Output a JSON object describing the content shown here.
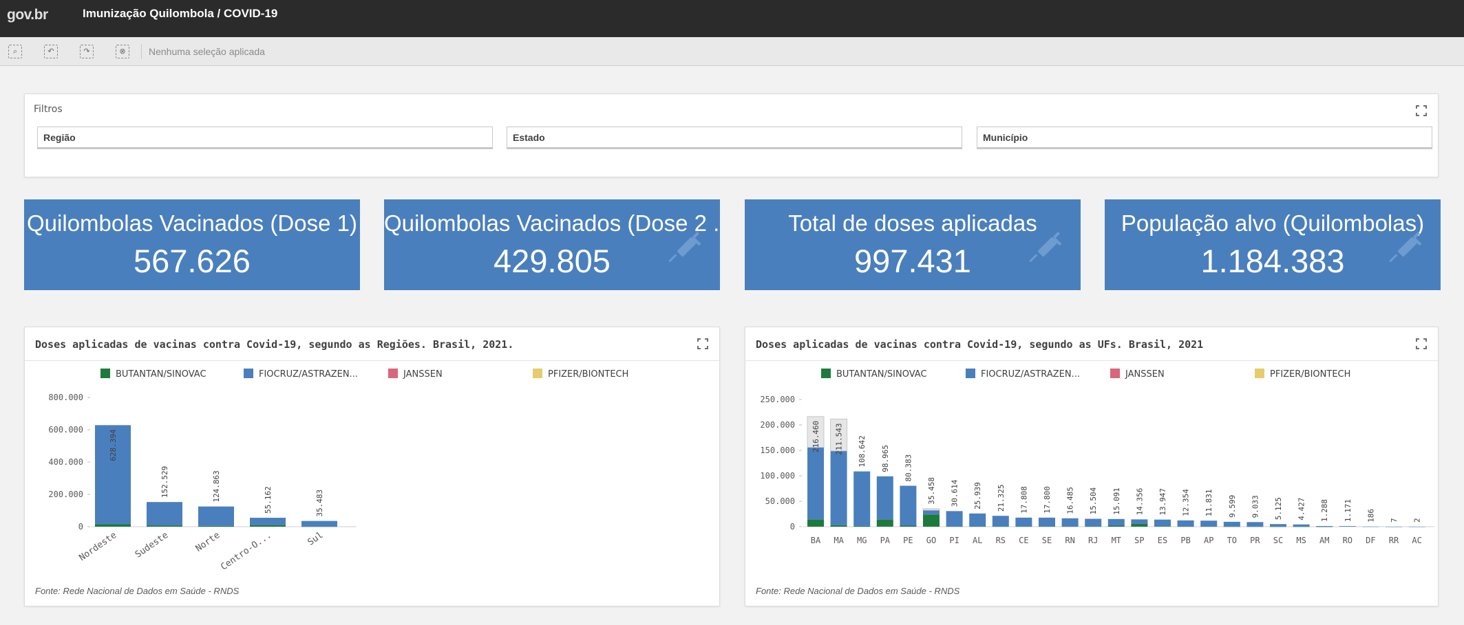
{
  "header": {
    "logo": "gov.br",
    "title": "Imunização Quilombola / COVID-19"
  },
  "toolbar": {
    "selection_text": "Nenhuma seleção aplicada"
  },
  "filters": {
    "title": "Filtros",
    "items": [
      {
        "label": "Região"
      },
      {
        "label": "Estado"
      },
      {
        "label": "Município"
      }
    ]
  },
  "kpis": [
    {
      "label": "Quilombolas Vacinados (Dose 1)",
      "value": "567.626",
      "icon": "syringe-icon"
    },
    {
      "label": "Quilombolas Vacinados (Dose 2 ...",
      "value": "429.805",
      "icon": "syringe-icon"
    },
    {
      "label": "Total de doses aplicadas",
      "value": "997.431",
      "icon": "syringe-icon"
    },
    {
      "label": "População alvo (Quilombolas)",
      "value": "1.184.383",
      "icon": "syringe-icon"
    }
  ],
  "colors": {
    "kpi_bg": "#4a7fbd",
    "butantan": "#1e7a3b",
    "fiocruz": "#4a7fbd",
    "janssen": "#d9667a",
    "pfizer": "#e6cc6e"
  },
  "chart_data": [
    {
      "type": "bar",
      "stacked": true,
      "title": "Doses aplicadas de vacinas contra Covid-19, segundo as Regiões. Brasil, 2021.",
      "source": "Fonte: Rede Nacional de Dados em Saúde - RNDS",
      "legend": [
        "BUTANTAN/SINOVAC",
        "FIOCRUZ/ASTRAZEN...",
        "JANSSEN",
        "PFIZER/BIONTECH"
      ],
      "legend_position": "top",
      "categories": [
        "Nordeste",
        "Sudeste",
        "Norte",
        "Centro-O...",
        "Sul"
      ],
      "totals": [
        628394,
        152529,
        124863,
        55162,
        35483
      ],
      "total_labels": [
        "628.394",
        "152.529",
        "124.863",
        "55.162",
        "35.483"
      ],
      "series": [
        {
          "name": "BUTANTAN/SINOVAC",
          "values": [
            15000,
            8000,
            5000,
            10000,
            1000
          ]
        },
        {
          "name": "FIOCRUZ/ASTRAZEN...",
          "values": [
            613394,
            144529,
            119863,
            45162,
            34483
          ]
        },
        {
          "name": "JANSSEN",
          "values": [
            0,
            0,
            0,
            0,
            0
          ]
        },
        {
          "name": "PFIZER/BIONTECH",
          "values": [
            0,
            0,
            0,
            0,
            0
          ]
        }
      ],
      "ylim": [
        0,
        800000
      ],
      "yticks": [
        0,
        200000,
        400000,
        600000,
        800000
      ],
      "ytick_labels": [
        "0",
        "200.000",
        "400.000",
        "600.000",
        "800.000"
      ],
      "grid": false
    },
    {
      "type": "bar",
      "stacked": true,
      "title": "Doses aplicadas de vacinas contra Covid-19, segundo as UFs. Brasil, 2021",
      "source": "Fonte: Rede Nacional de Dados em Saúde - RNDS",
      "legend": [
        "BUTANTAN/SINOVAC",
        "FIOCRUZ/ASTRAZEN...",
        "JANSSEN",
        "PFIZER/BIONTECH"
      ],
      "legend_position": "top",
      "categories": [
        "BA",
        "MA",
        "MG",
        "PA",
        "PE",
        "GO",
        "PI",
        "AL",
        "RS",
        "CE",
        "SE",
        "RN",
        "RJ",
        "MT",
        "SP",
        "ES",
        "PB",
        "AP",
        "TO",
        "PR",
        "SC",
        "MS",
        "AM",
        "RO",
        "DF",
        "RR",
        "AC"
      ],
      "totals": [
        216460,
        211543,
        108642,
        98965,
        80383,
        35458,
        30614,
        25939,
        21325,
        17808,
        17800,
        16485,
        15504,
        15091,
        14356,
        13947,
        12354,
        11831,
        9599,
        9033,
        5125,
        4427,
        1288,
        1171,
        186,
        7,
        2
      ],
      "total_labels": [
        "216.460",
        "211.543",
        "108.642",
        "98.965",
        "80.383",
        "35.458",
        "30.614",
        "25.939",
        "21.325",
        "17.808",
        "17.800",
        "16.485",
        "15.504",
        "15.091",
        "14.356",
        "13.947",
        "12.354",
        "11.831",
        "9.599",
        "9.033",
        "5.125",
        "4.427",
        "1.288",
        "1.171",
        "186",
        "7",
        "2"
      ],
      "series": [
        {
          "name": "BUTANTAN/SINOVAC",
          "values": [
            14000,
            3000,
            1500,
            14000,
            2000,
            24000,
            500,
            500,
            500,
            500,
            500,
            500,
            500,
            2000,
            5500,
            1000,
            500,
            500,
            300,
            300,
            200,
            200,
            100,
            0,
            0,
            0,
            0
          ]
        },
        {
          "name": "FIOCRUZ/ASTRAZEN...",
          "values": [
            142000,
            146000,
            107142,
            84965,
            78383,
            8458,
            30114,
            25439,
            20825,
            17308,
            17300,
            15985,
            15004,
            13091,
            8856,
            12947,
            11854,
            11331,
            9299,
            8733,
            4925,
            4227,
            1188,
            1171,
            186,
            7,
            2
          ]
        },
        {
          "name": "JANSSEN",
          "values": [
            0,
            0,
            0,
            0,
            0,
            0,
            0,
            0,
            0,
            0,
            0,
            0,
            0,
            0,
            0,
            0,
            0,
            0,
            0,
            0,
            0,
            0,
            0,
            0,
            0,
            0,
            0
          ]
        },
        {
          "name": "PFIZER/BIONTECH",
          "values": [
            60460,
            62543,
            0,
            0,
            0,
            3000,
            0,
            0,
            0,
            0,
            0,
            0,
            0,
            0,
            0,
            0,
            0,
            0,
            0,
            0,
            0,
            0,
            0,
            0,
            0,
            0,
            0
          ]
        }
      ],
      "ylim": [
        0,
        250000
      ],
      "yticks": [
        0,
        50000,
        100000,
        150000,
        200000,
        250000
      ],
      "ytick_labels": [
        "0",
        "50.000",
        "100.000",
        "150.000",
        "200.000",
        "250.000"
      ],
      "grid": false
    }
  ]
}
